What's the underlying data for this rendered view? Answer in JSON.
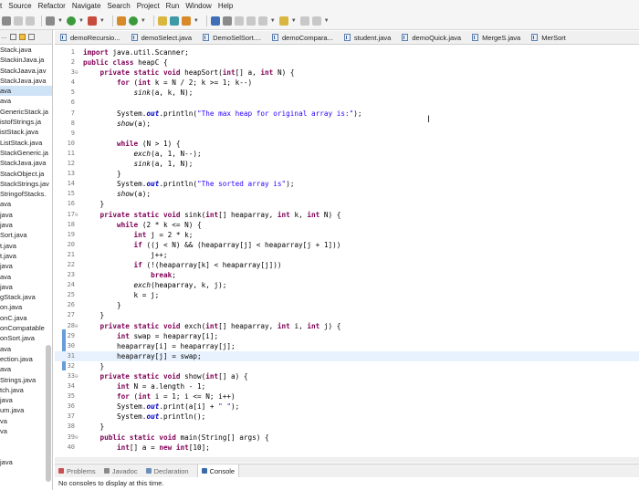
{
  "menu": [
    "t",
    "Source",
    "Refactor",
    "Navigate",
    "Search",
    "Project",
    "Run",
    "Window",
    "Help"
  ],
  "explorer": {
    "tab_label": "…",
    "files": [
      "Stack.java",
      "StackinJava.ja",
      "StackJaava.jav",
      "StackJava.java",
      "ava",
      "ava",
      "GenericStack.ja",
      "istofStrings.ja",
      "istStack.java",
      "ListStack.java",
      "StackGeneric.ja",
      "StackJava.java",
      "StackObject.ja",
      "StackStrings.jav",
      "StringofStacks.",
      "ava",
      "java",
      "java",
      "Sort.java",
      "t.java",
      "t.java",
      "java",
      "ava",
      "java",
      "gStack.java",
      "on.java",
      "onC.java",
      "onCompatable",
      "onSort.java",
      "ava",
      "ection.java",
      "ava",
      "Strings.java",
      "tch.java",
      "java",
      "um.java",
      "va",
      "va",
      "",
      "",
      "java"
    ],
    "selected_index": 4
  },
  "tabs": [
    "demoRecursio...",
    "demoSelect.java",
    "DemoSelSort....",
    "demoCompara...",
    "student.java",
    "demoQuick.java",
    "MergeS.java",
    "MerSort"
  ],
  "editor": {
    "lines": [
      {
        "n": "1",
        "fold": "",
        "html": "<span class='kw'>import</span> java.util.Scanner;"
      },
      {
        "n": "2",
        "fold": "",
        "html": "<span class='kw'>public class</span> heapC {"
      },
      {
        "n": "3",
        "fold": "⊖",
        "html": "    <span class='kw'>private static void</span> heapSort(<span class='kw'>int</span>[] a, <span class='kw'>int</span> N) {"
      },
      {
        "n": "4",
        "fold": "",
        "html": "        <span class='kw'>for</span> (<span class='kw'>int</span> k = N / 2; k >= 1; k--)"
      },
      {
        "n": "5",
        "fold": "",
        "html": "            <span class='it'>sink</span>(a, k, N);"
      },
      {
        "n": "6",
        "fold": "",
        "html": ""
      },
      {
        "n": "7",
        "fold": "",
        "html": "        System.<span class='fld'>out</span>.println(<span class='str'>\"The max heap for original array is:\"</span>);"
      },
      {
        "n": "8",
        "fold": "",
        "html": "        <span class='it'>show</span>(a);"
      },
      {
        "n": "9",
        "fold": "",
        "html": ""
      },
      {
        "n": "10",
        "fold": "",
        "html": "        <span class='kw'>while</span> (N > 1) {"
      },
      {
        "n": "11",
        "fold": "",
        "html": "            <span class='it'>exch</span>(a, 1, N--);"
      },
      {
        "n": "12",
        "fold": "",
        "html": "            <span class='it'>sink</span>(a, 1, N);"
      },
      {
        "n": "13",
        "fold": "",
        "html": "        }"
      },
      {
        "n": "14",
        "fold": "",
        "html": "        System.<span class='fld'>out</span>.println(<span class='str'>\"The sorted array is\"</span>);"
      },
      {
        "n": "15",
        "fold": "",
        "html": "        <span class='it'>show</span>(a);"
      },
      {
        "n": "16",
        "fold": "",
        "html": "    }"
      },
      {
        "n": "17",
        "fold": "⊖",
        "html": "    <span class='kw'>private static void</span> sink(<span class='kw'>int</span>[] heaparray, <span class='kw'>int</span> k, <span class='kw'>int</span> N) {"
      },
      {
        "n": "18",
        "fold": "",
        "html": "        <span class='kw'>while</span> (2 * k <= N) {"
      },
      {
        "n": "19",
        "fold": "",
        "html": "            <span class='kw'>int</span> j = 2 * k;"
      },
      {
        "n": "20",
        "fold": "",
        "html": "            <span class='kw'>if</span> ((j < N) && (heaparray[j] < heaparray[j + 1]))"
      },
      {
        "n": "21",
        "fold": "",
        "html": "                j++;"
      },
      {
        "n": "22",
        "fold": "",
        "html": "            <span class='kw'>if</span> (!(heaparray[k] < heaparray[j]))"
      },
      {
        "n": "23",
        "fold": "",
        "html": "                <span class='kw'>break</span>;"
      },
      {
        "n": "24",
        "fold": "",
        "html": "            <span class='it'>exch</span>(heaparray, k, j);"
      },
      {
        "n": "25",
        "fold": "",
        "html": "            k = j;"
      },
      {
        "n": "26",
        "fold": "",
        "html": "        }"
      },
      {
        "n": "27",
        "fold": "",
        "html": "    }"
      },
      {
        "n": "28",
        "fold": "⊖",
        "html": "    <span class='kw'>private static void</span> exch(<span class='kw'>int</span>[] heaparray, <span class='kw'>int</span> i, <span class='kw'>int</span> j) {"
      },
      {
        "n": "29",
        "fold": "",
        "html": "        <span class='kw'>int</span> swap = heaparray[i];"
      },
      {
        "n": "30",
        "fold": "",
        "html": "        heaparray[i] = heaparray[j];"
      },
      {
        "n": "31",
        "fold": "",
        "html": "        heaparray[j] = swap;"
      },
      {
        "n": "32",
        "fold": "",
        "html": "    }"
      },
      {
        "n": "33",
        "fold": "⊖",
        "html": "    <span class='kw'>private static void</span> show(<span class='kw'>int</span>[] a) {"
      },
      {
        "n": "34",
        "fold": "",
        "html": "        <span class='kw'>int</span> N = a.length - 1;"
      },
      {
        "n": "35",
        "fold": "",
        "html": "        <span class='kw'>for</span> (<span class='kw'>int</span> i = 1; i <= N; i++)"
      },
      {
        "n": "36",
        "fold": "",
        "html": "        System.<span class='fld'>out</span>.print(a[i] + <span class='str'>\" \"</span>);"
      },
      {
        "n": "37",
        "fold": "",
        "html": "        System.<span class='fld'>out</span>.println();"
      },
      {
        "n": "38",
        "fold": "",
        "html": "    }"
      },
      {
        "n": "39",
        "fold": "⊖",
        "html": "    <span class='kw'>public static void</span> main(String[] args) {"
      },
      {
        "n": "40",
        "fold": "",
        "html": "        <span class='kw'>int</span>[] a = <span class='kw'>new int</span>[10];"
      }
    ],
    "current_line": "31"
  },
  "bottom": {
    "tabs": [
      {
        "label": "Problems",
        "color": "#c85050",
        "active": false
      },
      {
        "label": "Javadoc",
        "color": "#8a8a8a",
        "active": false
      },
      {
        "label": "Declaration",
        "color": "#6a8fb8",
        "active": false
      },
      {
        "label": "Console",
        "color": "#3a6aa8",
        "active": true
      }
    ],
    "console_message": "No consoles to display at this time."
  }
}
